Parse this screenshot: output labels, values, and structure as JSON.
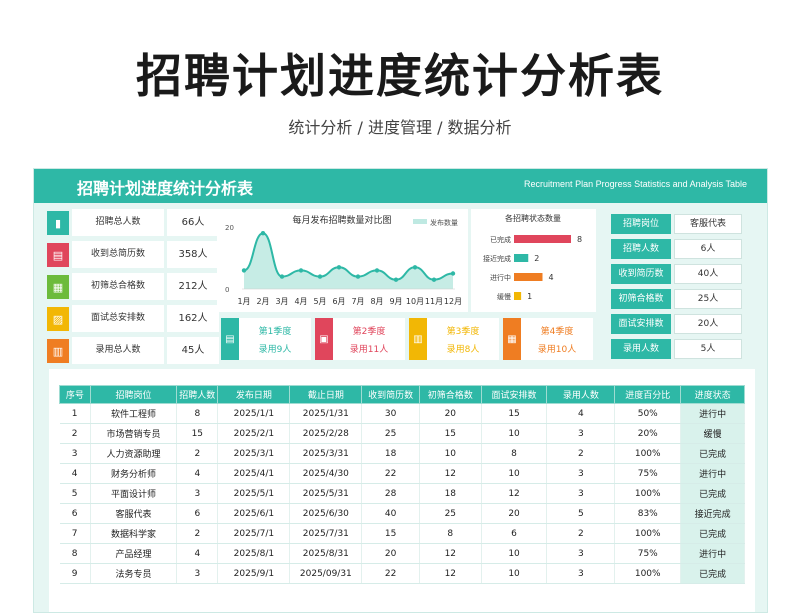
{
  "page": {
    "title": "招聘计划进度统计分析表",
    "subtitle": "统计分析 / 进度管理  / 数据分析"
  },
  "banner": {
    "title_cn": "招聘计划进度统计分析表",
    "title_en": "Recruitment Plan Progress Statistics and Analysis Table"
  },
  "summary": [
    {
      "label": "招聘总人数",
      "value": "66人",
      "color": "#2eb8a6"
    },
    {
      "label": "收到总简历数",
      "value": "358人",
      "color": "#e0465c"
    },
    {
      "label": "初筛总合格数",
      "value": "212人",
      "color": "#6cbb3c"
    },
    {
      "label": "面试总安排数",
      "value": "162人",
      "color": "#f2b705"
    },
    {
      "label": "录用总人数",
      "value": "45人",
      "color": "#ef7d22"
    }
  ],
  "chart_data": [
    {
      "type": "area",
      "title": "每月发布招聘数量对比图",
      "legend": "发布数量",
      "legend_position": "top-right",
      "categories": [
        "1月",
        "2月",
        "3月",
        "4月",
        "5月",
        "6月",
        "7月",
        "8月",
        "9月",
        "10月",
        "11月",
        "12月"
      ],
      "values": [
        6,
        18,
        4,
        6,
        4,
        7,
        4,
        6,
        3,
        7,
        3,
        5
      ],
      "ylim": [
        0,
        20
      ],
      "yticks": [
        "0",
        "20"
      ],
      "color": "#2eb8a6"
    },
    {
      "type": "bar",
      "orientation": "horizontal",
      "title": "各招聘状态数量",
      "categories": [
        "已完成",
        "接近完成",
        "进行中",
        "缓慢"
      ],
      "values": [
        8,
        2,
        4,
        1
      ],
      "colors": [
        "#e0465c",
        "#2eb8a6",
        "#ef7d22",
        "#f2b705"
      ],
      "xlim": [
        0,
        8
      ]
    }
  ],
  "quarters": [
    {
      "name": "第1季度",
      "value": "录用9人",
      "color": "#2eb8a6"
    },
    {
      "name": "第2季度",
      "value": "录用11人",
      "color": "#e0465c"
    },
    {
      "name": "第3季度",
      "value": "录用8人",
      "color": "#f2b705"
    },
    {
      "name": "第4季度",
      "value": "录用10人",
      "color": "#ef7d22"
    }
  ],
  "detail": [
    {
      "label": "招聘岗位",
      "value": "客服代表"
    },
    {
      "label": "招聘人数",
      "value": "6人"
    },
    {
      "label": "收到简历数",
      "value": "40人"
    },
    {
      "label": "初筛合格数",
      "value": "25人"
    },
    {
      "label": "面试安排数",
      "value": "20人"
    },
    {
      "label": "录用人数",
      "value": "5人"
    }
  ],
  "table": {
    "headers": [
      "序号",
      "招聘岗位",
      "招聘人数",
      "发布日期",
      "截止日期",
      "收到简历数",
      "初筛合格数",
      "面试安排数",
      "录用人数",
      "进度百分比",
      "进度状态"
    ],
    "rows": [
      [
        "1",
        "软件工程师",
        "8",
        "2025/1/1",
        "2025/1/31",
        "30",
        "20",
        "15",
        "4",
        "50%",
        "进行中"
      ],
      [
        "2",
        "市场营销专员",
        "15",
        "2025/2/1",
        "2025/2/28",
        "25",
        "15",
        "10",
        "3",
        "20%",
        "缓慢"
      ],
      [
        "3",
        "人力资源助理",
        "2",
        "2025/3/1",
        "2025/3/31",
        "18",
        "10",
        "8",
        "2",
        "100%",
        "已完成"
      ],
      [
        "4",
        "财务分析师",
        "4",
        "2025/4/1",
        "2025/4/30",
        "22",
        "12",
        "10",
        "3",
        "75%",
        "进行中"
      ],
      [
        "5",
        "平面设计师",
        "3",
        "2025/5/1",
        "2025/5/31",
        "28",
        "18",
        "12",
        "3",
        "100%",
        "已完成"
      ],
      [
        "6",
        "客服代表",
        "6",
        "2025/6/1",
        "2025/6/30",
        "40",
        "25",
        "20",
        "5",
        "83%",
        "接近完成"
      ],
      [
        "7",
        "数据科学家",
        "2",
        "2025/7/1",
        "2025/7/31",
        "15",
        "8",
        "6",
        "2",
        "100%",
        "已完成"
      ],
      [
        "8",
        "产品经理",
        "4",
        "2025/8/1",
        "2025/8/31",
        "20",
        "12",
        "10",
        "3",
        "75%",
        "进行中"
      ],
      [
        "9",
        "法务专员",
        "3",
        "2025/9/1",
        "2025/09/31",
        "22",
        "12",
        "10",
        "3",
        "100%",
        "已完成"
      ]
    ]
  }
}
